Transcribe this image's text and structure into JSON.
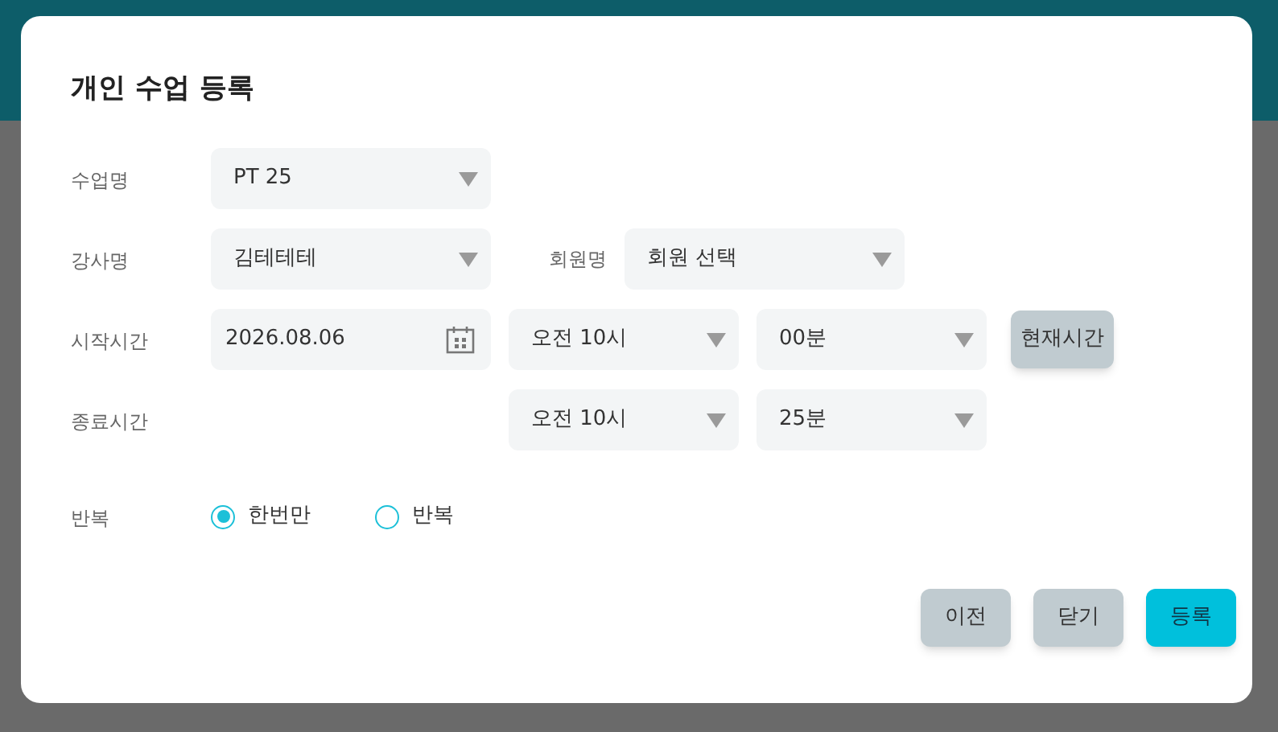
{
  "dialog": {
    "title": "개인 수업 등록",
    "rows": [
      {
        "label": "수업명",
        "controls": [
          {
            "kind": "select",
            "value": "PT 25"
          }
        ]
      },
      {
        "label": "강사명",
        "controls": [
          {
            "kind": "select",
            "value": "김테테테"
          },
          {
            "kind": "label",
            "text": "회원명"
          },
          {
            "kind": "select",
            "value": "회원 선택"
          }
        ]
      },
      {
        "label": "시작시간",
        "controls": [
          {
            "kind": "date",
            "value": "2026.08.06"
          },
          {
            "kind": "time",
            "value": "오전 10시"
          },
          {
            "kind": "time",
            "value": "00분"
          },
          {
            "kind": "button",
            "text": "현재시간"
          }
        ]
      },
      {
        "label": "종료시간",
        "controls": [
          {
            "kind": "blank"
          },
          {
            "kind": "time",
            "value": "오전 10시"
          },
          {
            "kind": "time",
            "value": "25분"
          }
        ]
      }
    ],
    "repeat": {
      "label": "반복",
      "options": [
        {
          "label": "한번만",
          "selected": true
        },
        {
          "label": "반복",
          "selected": false
        }
      ]
    },
    "buttons": [
      {
        "text": "이전",
        "kind": "secondary"
      },
      {
        "text": "닫기",
        "kind": "secondary"
      },
      {
        "text": "등록",
        "kind": "primary"
      }
    ]
  }
}
